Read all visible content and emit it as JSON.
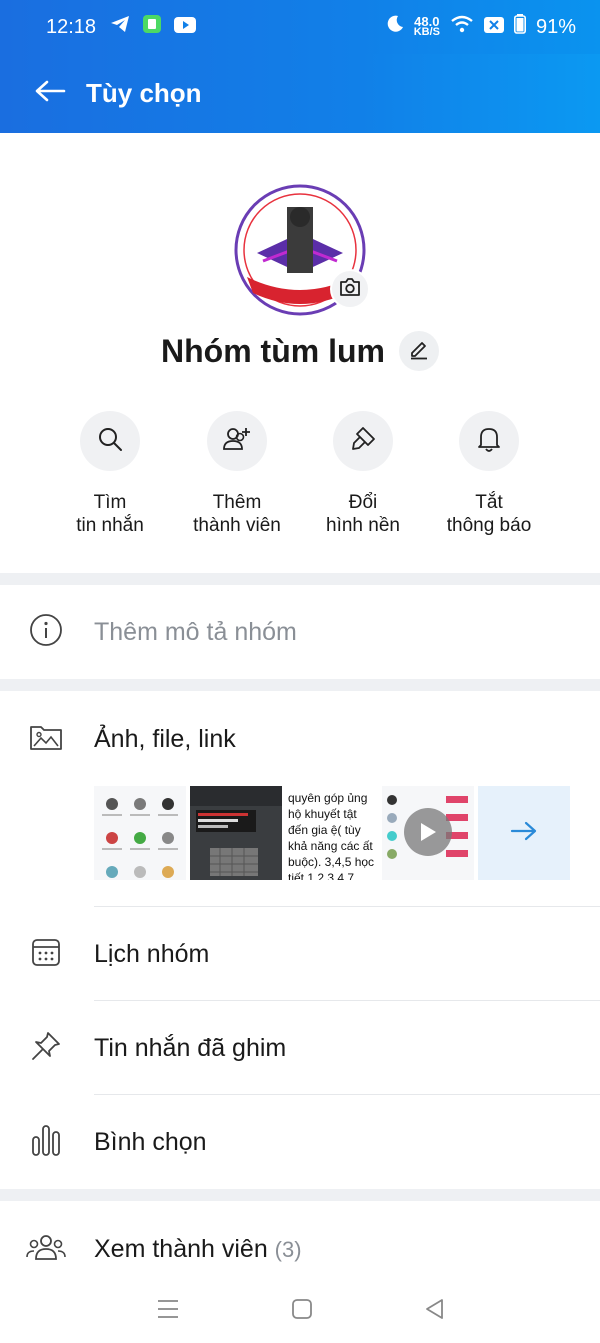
{
  "status_bar": {
    "time": "12:18",
    "net_speed_value": "48.0",
    "net_speed_unit": "KB/S",
    "battery": "91%"
  },
  "header": {
    "title": "Tùy chọn",
    "back_icon": "arrow-left-icon"
  },
  "group": {
    "name": "Nhóm tùm lum"
  },
  "actions": [
    {
      "line1": "Tìm",
      "line2": "tin nhắn",
      "icon": "search-icon"
    },
    {
      "line1": "Thêm",
      "line2": "thành viên",
      "icon": "add-member-icon"
    },
    {
      "line1": "Đổi",
      "line2": "hình nền",
      "icon": "paint-icon"
    },
    {
      "line1": "Tắt",
      "line2": "thông báo",
      "icon": "bell-icon"
    }
  ],
  "description": {
    "placeholder": "Thêm mô tả nhóm"
  },
  "media_section": {
    "label": "Ảnh, file, link",
    "doc_thumb_text": "quyên góp ủng hộ khuyết tật đến gia ệ( tùy khả năng các ất buộc). 3,4,5 học tiết 1,2,3,4 7."
  },
  "menu": {
    "calendar": "Lịch nhóm",
    "pinned": "Tin nhắn đã ghim",
    "poll": "Bình chọn",
    "members": "Xem thành viên",
    "members_count": "(3)"
  },
  "colors": {
    "brand_blue": "#1180e8",
    "accent_arrow": "#2a8ad8"
  }
}
